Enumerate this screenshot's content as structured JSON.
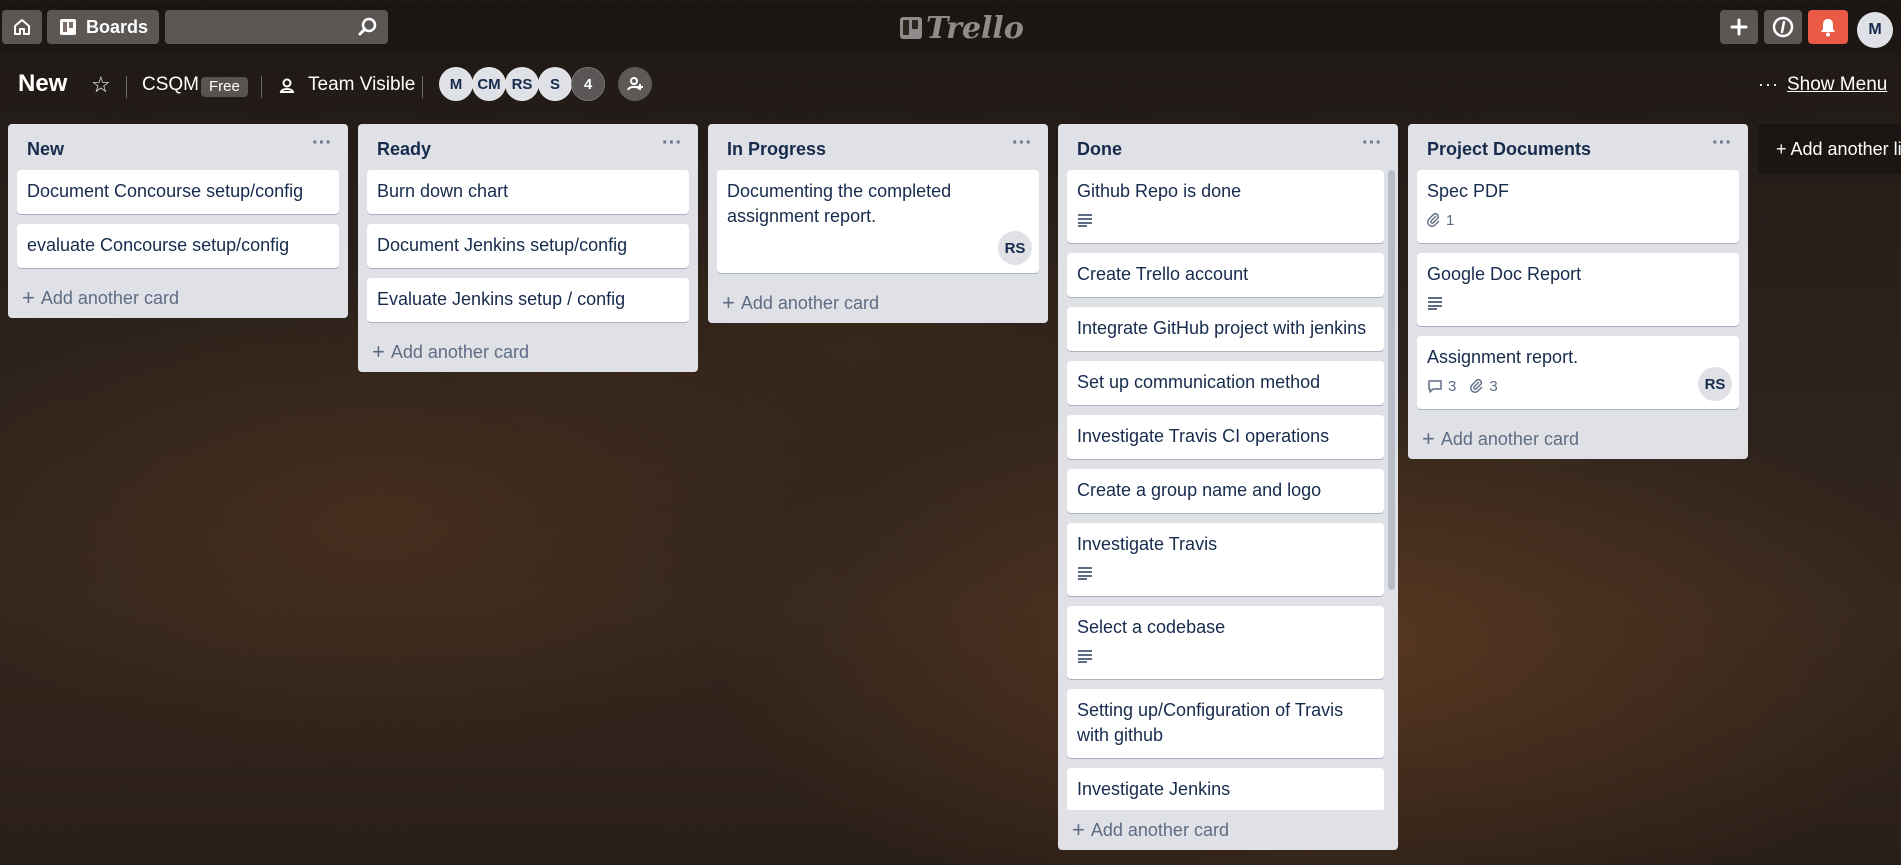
{
  "header": {
    "boards_label": "Boards",
    "search_placeholder": "",
    "logo_text": "Trello",
    "avatar_initial": "M",
    "icons": [
      "home-icon",
      "boards-icon",
      "search-icon",
      "plus-icon",
      "info-icon",
      "bell-icon"
    ],
    "notification_color": "#eb5a46"
  },
  "board": {
    "title": "New",
    "team": "CSQM",
    "plan": "Free",
    "visibility": "Team Visible",
    "members": [
      "M",
      "CM",
      "RS",
      "S"
    ],
    "more_members": "4",
    "menu_dots": "···",
    "show_menu": "Show Menu",
    "add_list": "+ Add another list"
  },
  "lists": [
    {
      "title": "New",
      "cards": [
        {
          "title": "Document Concourse setup/config"
        },
        {
          "title": "evaluate Concourse setup/config"
        }
      ],
      "add_card": "Add another card"
    },
    {
      "title": "Ready",
      "cards": [
        {
          "title": "Burn down chart"
        },
        {
          "title": "Document Jenkins setup/config"
        },
        {
          "title": "Evaluate Jenkins setup / config"
        }
      ],
      "add_card": "Add another card"
    },
    {
      "title": "In Progress",
      "cards": [
        {
          "title": "Documenting the completed assignment report.",
          "member": "RS"
        }
      ],
      "add_card": "Add another card"
    },
    {
      "title": "Done",
      "cards": [
        {
          "title": "Github Repo is done",
          "description": true
        },
        {
          "title": "Create Trello account"
        },
        {
          "title": "Integrate GitHub project with jenkins"
        },
        {
          "title": "Set up communication method"
        },
        {
          "title": "Investigate Travis CI operations"
        },
        {
          "title": "Create a group name and logo"
        },
        {
          "title": "Investigate Travis",
          "description": true
        },
        {
          "title": "Select a codebase",
          "description": true
        },
        {
          "title": "Setting up/Configuration of Travis with github"
        },
        {
          "title": "Investigate Jenkins"
        }
      ],
      "add_card": "Add another card"
    },
    {
      "title": "Project Documents",
      "cards": [
        {
          "title": "Spec PDF",
          "attachments": "1"
        },
        {
          "title": "Google Doc Report",
          "description": true
        },
        {
          "title": "Assignment report.",
          "comments": "3",
          "attachments": "3",
          "member": "RS"
        }
      ],
      "add_card": "Add another card"
    }
  ]
}
